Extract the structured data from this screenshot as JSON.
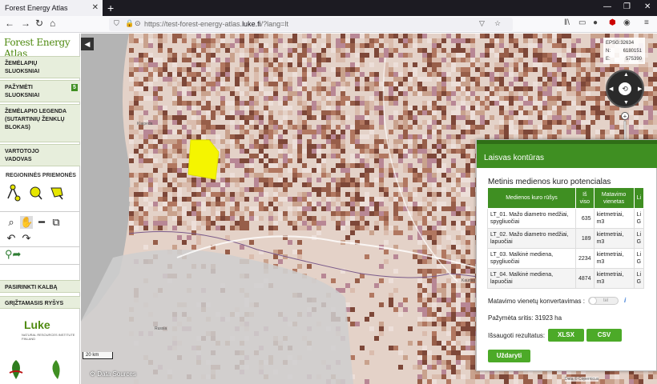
{
  "browser": {
    "tab_title": "Forest Energy Atlas",
    "url_prefix": "https://test-forest-energy-atlas.",
    "url_domain": "luke.fi",
    "url_suffix": "/?lang=lt"
  },
  "sidebar": {
    "logo": "Forest Energy Atlas",
    "menu": [
      {
        "label": "ŽEMĖLAPIŲ SLUOKSNIAI"
      },
      {
        "label": "PAŽYMĖTI SLUOKSNIAI",
        "badge": "5"
      },
      {
        "label": "ŽEMĖLAPIO LEGENDA (SUTARTINIŲ ŽENKLŲ BLOKAS)"
      },
      {
        "label": "VARTOTOJO VADOVAS"
      }
    ],
    "regional_tools_title": "REGIONINĖS PRIEMONĖS",
    "bottom_menu": [
      {
        "label": "PASIRINKTI KALBĄ"
      },
      {
        "label": "GRĮŽTAMASIS RYŠYS"
      }
    ],
    "partner_logo": "Luke",
    "partner_sub": "NATURAL RESOURCES INSTITUTE FINLAND"
  },
  "map": {
    "coords": {
      "crs": "EPSG:32634",
      "n_label": "N:",
      "n_value": "6180151",
      "e_label": "E:",
      "e_value": "575390"
    },
    "scale": "20 km",
    "data_sources": "Data Sources",
    "attribution": "Data © Copernicus",
    "place_labels": [
      "Klaipėda",
      "Russia",
      "Kaunas"
    ]
  },
  "dialog": {
    "title": "Laisvas kontūras",
    "subtitle": "Metinis medienos kuro potencialas",
    "columns": [
      "Medienos kuro rūšys",
      "Iš viso",
      "Matavimo vienetas",
      "Li"
    ],
    "rows": [
      {
        "type": "LT_01. Mažo diametro medžiai, spygliuočiai",
        "total": "635",
        "unit": "kietmetriai, m3",
        "extra": "Li G"
      },
      {
        "type": "LT_02. Mažo diametro medžiai, lapuočiai",
        "total": "189",
        "unit": "kietmetriai, m3",
        "extra": "Li G"
      },
      {
        "type": "LT_03. Malkinė mediena, spygliuočiai",
        "total": "2234",
        "unit": "kietmetriai, m3",
        "extra": "Li G"
      },
      {
        "type": "LT_04. Malkinė mediena, lapuočiai",
        "total": "4874",
        "unit": "kietmetriai, m3",
        "extra": "Li G"
      }
    ],
    "conversion_label": "Matavimo vienetų konvertavimas :",
    "toggle_text": "tel",
    "selected_area": "Pažymėta sritis: 31923 ha",
    "save_label": "Išsaugoti rezultatus:",
    "btn_xlsx": "XLSX",
    "btn_csv": "CSV",
    "btn_close": "Uždaryti"
  },
  "colors": {
    "brand_green": "#3f8f22",
    "button_green": "#4caa28",
    "selection_yellow": "#f5f500"
  }
}
